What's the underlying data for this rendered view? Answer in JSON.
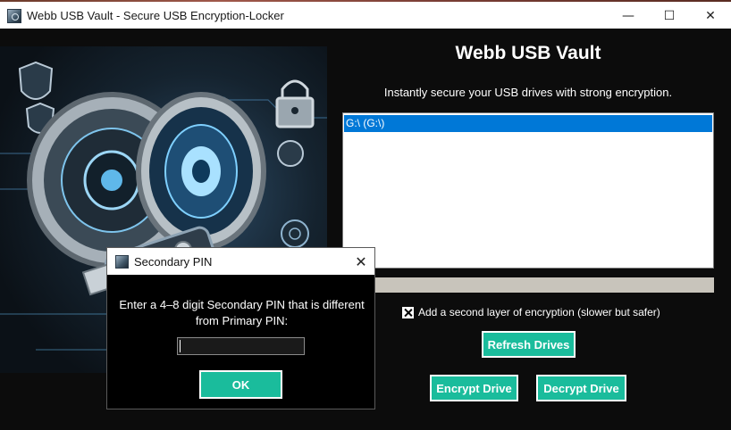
{
  "window": {
    "title": "Webb USB Vault - Secure USB Encryption-Locker",
    "minimize": "—",
    "maximize": "☐",
    "close": "✕"
  },
  "header": {
    "title": "Webb USB Vault",
    "subtitle": "Instantly secure your USB drives with strong encryption."
  },
  "drives": {
    "items": [
      {
        "label": "G:\\ (G:\\)",
        "selected": true
      }
    ]
  },
  "progress": {
    "value": 0
  },
  "options": {
    "second_layer_label": "Add a second layer of encryption (slower but safer)",
    "second_layer_checked": true
  },
  "buttons": {
    "refresh": "Refresh Drives",
    "encrypt": "Encrypt Drive",
    "decrypt": "Decrypt Drive"
  },
  "dialog": {
    "title": "Secondary PIN",
    "close": "✕",
    "message": "Enter a 4–8 digit Secondary PIN that is different from Primary PIN:",
    "pin_value": "",
    "ok_label": "OK"
  },
  "colors": {
    "accent": "#1abc9c",
    "selection": "#0078d7",
    "background": "#0c0c0c"
  },
  "icons": [
    "app-icon",
    "lock-icon",
    "shield-icon",
    "usb-drive-icon"
  ]
}
